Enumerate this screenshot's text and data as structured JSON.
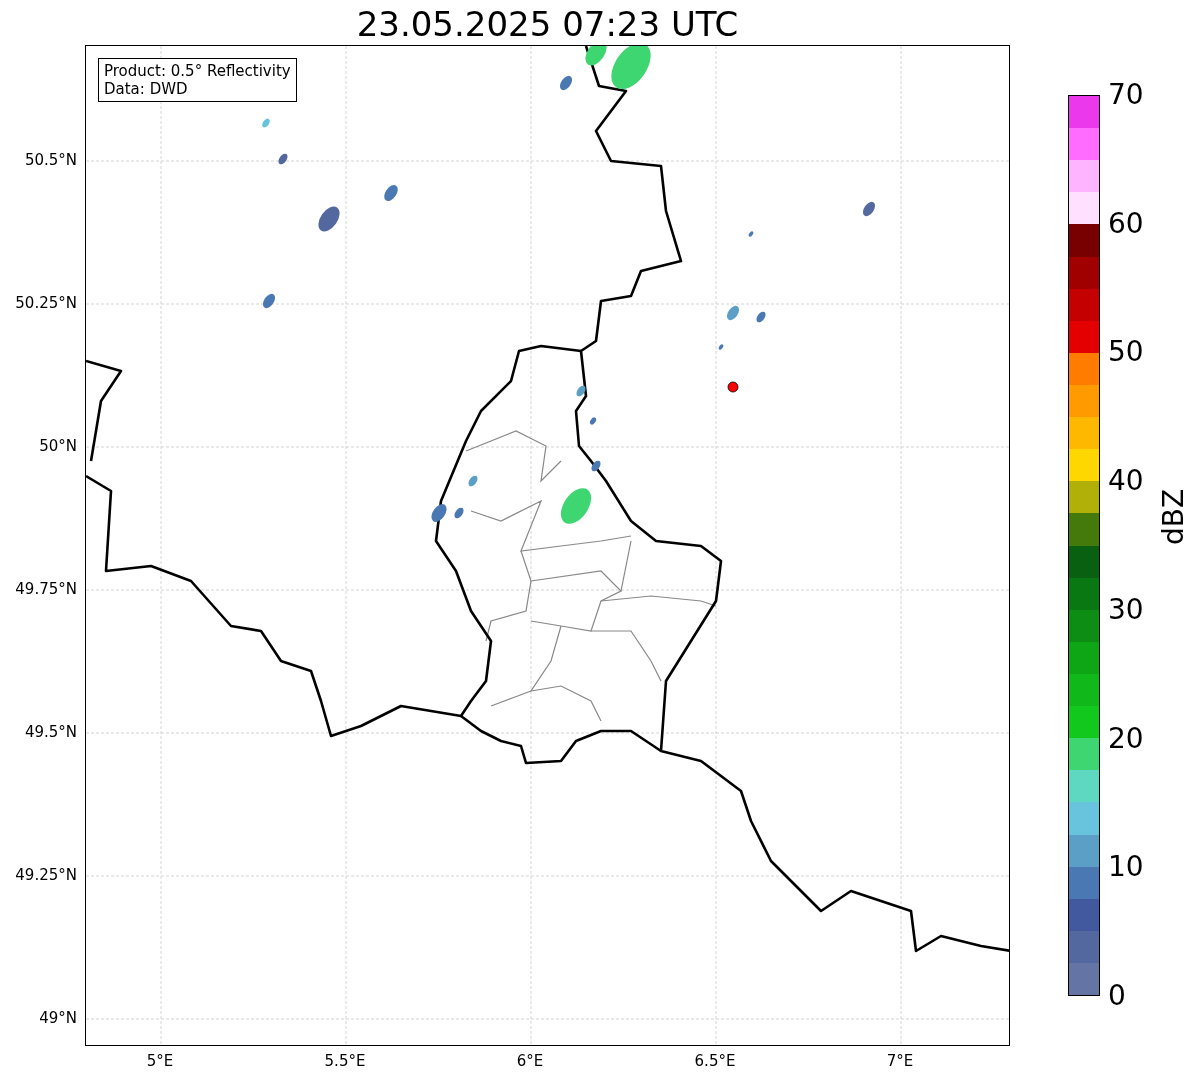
{
  "title": "23.05.2025 07:23 UTC",
  "legend": {
    "lines": [
      "Product: 0.5° Reflectivity",
      "Data: DWD"
    ]
  },
  "map": {
    "lat_ticks": [
      "50.5°N",
      "50.25°N",
      "50°N",
      "49.75°N",
      "49.5°N",
      "49.25°N",
      "49°N"
    ],
    "lon_ticks": [
      "5°E",
      "5.5°E",
      "6°E",
      "6.5°E",
      "7°E"
    ]
  },
  "colorbar": {
    "label": "dBZ",
    "ticks": [
      "70",
      "60",
      "50",
      "40",
      "30",
      "20",
      "10",
      "0"
    ],
    "segments": [
      {
        "color": "#ec38ec"
      },
      {
        "color": "#ff6cff"
      },
      {
        "color": "#ffb4ff"
      },
      {
        "color": "#ffe0ff"
      },
      {
        "color": "#780000"
      },
      {
        "color": "#a00000"
      },
      {
        "color": "#c40000"
      },
      {
        "color": "#e40000"
      },
      {
        "color": "#ff7c00"
      },
      {
        "color": "#ff9a00"
      },
      {
        "color": "#ffb800"
      },
      {
        "color": "#ffd700"
      },
      {
        "color": "#b0b008"
      },
      {
        "color": "#447a0c"
      },
      {
        "color": "#086010"
      },
      {
        "color": "#0a7812"
      },
      {
        "color": "#0e8d14"
      },
      {
        "color": "#0fa616"
      },
      {
        "color": "#10b81a"
      },
      {
        "color": "#12c81c"
      },
      {
        "color": "#3ed670"
      },
      {
        "color": "#5fd8c2"
      },
      {
        "color": "#68c3dc"
      },
      {
        "color": "#5c9fc6"
      },
      {
        "color": "#4a78b2"
      },
      {
        "color": "#42599f"
      },
      {
        "color": "#5468a0"
      },
      {
        "color": "#6474a4"
      }
    ]
  }
}
